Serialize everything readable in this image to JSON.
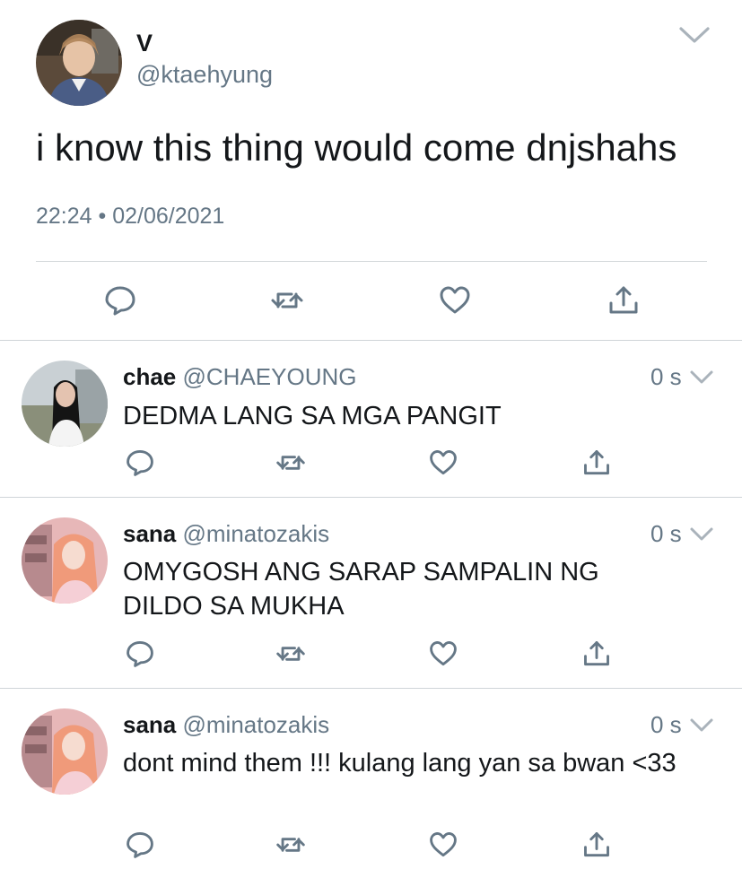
{
  "main_tweet": {
    "author_name": "V",
    "author_handle": "@ktaehyung",
    "text": "i know this thing would come dnjshahs",
    "meta": "22:24 • 02/06/2021"
  },
  "replies": [
    {
      "name": "chae",
      "handle": "@CHAEYOUNG",
      "time": "0 s",
      "text": "DEDMA LANG SA MGA PANGIT"
    },
    {
      "name": "sana",
      "handle": "@minatozakis",
      "time": "0 s",
      "text": "OMYGOSH ANG SARAP SAMPALIN NG DILDO SA MUKHA"
    },
    {
      "name": "sana",
      "handle": "@minatozakis",
      "time": "0 s",
      "text": "dont mind them !!! kulang lang yan sa bwan <33"
    }
  ],
  "icons": {
    "reply": "reply-icon",
    "retweet": "retweet-icon",
    "like": "like-icon",
    "share": "share-icon",
    "menu": "chevron-down-icon"
  },
  "colors": {
    "icon_gray": "#657786",
    "text": "#14171a",
    "divider": "#cfd4d8"
  }
}
